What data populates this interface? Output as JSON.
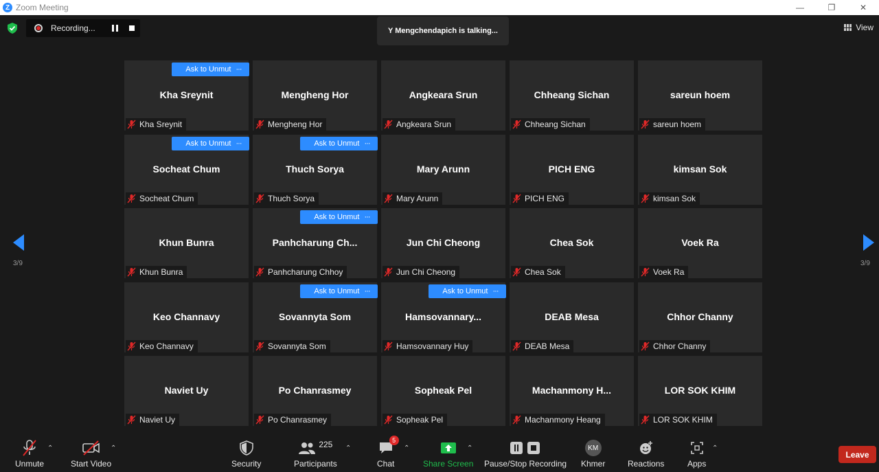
{
  "window": {
    "title": "Zoom Meeting",
    "logo": "Z"
  },
  "recording": {
    "label": "Recording..."
  },
  "talking": "Y Mengchendapich is talking...",
  "view": {
    "label": "View"
  },
  "pagination": {
    "left": "3/9",
    "right": "3/9"
  },
  "ask_to_unmute_label": "Ask to Unmute",
  "more_label": "···",
  "participants": [
    {
      "name": "Kha Sreynit",
      "display": "Kha Sreynit",
      "ask": true
    },
    {
      "name": "Mengheng Hor",
      "display": "Mengheng Hor",
      "ask": false
    },
    {
      "name": "Angkeara Srun",
      "display": "Angkeara Srun",
      "ask": false
    },
    {
      "name": "Chheang Sichan",
      "display": "Chheang Sichan",
      "ask": false
    },
    {
      "name": "sareun hoem",
      "display": "sareun hoem",
      "ask": false
    },
    {
      "name": "Socheat Chum",
      "display": "Socheat Chum",
      "ask": true
    },
    {
      "name": "Thuch Sorya",
      "display": "Thuch Sorya",
      "ask": true
    },
    {
      "name": "Mary Arunn",
      "display": "Mary Arunn",
      "ask": false
    },
    {
      "name": "PICH ENG",
      "display": "PICH ENG",
      "ask": false
    },
    {
      "name": "kimsan Sok",
      "display": "kimsan Sok",
      "ask": false
    },
    {
      "name": "Khun Bunra",
      "display": "Khun Bunra",
      "ask": false
    },
    {
      "name": "Panhcharung Chhoy",
      "display": "Panhcharung  Ch...",
      "ask": true
    },
    {
      "name": "Jun Chi Cheong",
      "display": "Jun Chi Cheong",
      "ask": false
    },
    {
      "name": "Chea Sok",
      "display": "Chea Sok",
      "ask": false
    },
    {
      "name": "Voek Ra",
      "display": "Voek Ra",
      "ask": false
    },
    {
      "name": "Keo Channavy",
      "display": "Keo Channavy",
      "ask": false
    },
    {
      "name": "Sovannyta Som",
      "display": "Sovannyta Som",
      "ask": true
    },
    {
      "name": "Hamsovannary Huy",
      "display": "Hamsovannary...",
      "ask": true
    },
    {
      "name": "DEAB Mesa",
      "display": "DEAB Mesa",
      "ask": false
    },
    {
      "name": "Chhor Channy",
      "display": "Chhor Channy",
      "ask": false
    },
    {
      "name": "Naviet Uy",
      "display": "Naviet Uy",
      "ask": false
    },
    {
      "name": "Po Chanrasmey",
      "display": "Po Chanrasmey",
      "ask": false
    },
    {
      "name": "Sopheak Pel",
      "display": "Sopheak Pel",
      "ask": false
    },
    {
      "name": "Machanmony Heang",
      "display": "Machanmony  H...",
      "ask": false
    },
    {
      "name": "LOR SOK KHIM",
      "display": "LOR SOK KHIM",
      "ask": false
    }
  ],
  "toolbar": {
    "unmute": "Unmute",
    "start_video": "Start Video",
    "security": "Security",
    "participants": "Participants",
    "participants_count": "225",
    "chat": "Chat",
    "chat_badge": "5",
    "share_screen": "Share Screen",
    "pause_stop": "Pause/Stop Recording",
    "khmer": "Khmer",
    "khmer_initials": "KM",
    "reactions": "Reactions",
    "apps": "Apps",
    "leave": "Leave"
  },
  "colors": {
    "accent": "#2d8cff",
    "leave": "#c2281d",
    "share": "#1fbd4c",
    "muted": "#e02828"
  }
}
